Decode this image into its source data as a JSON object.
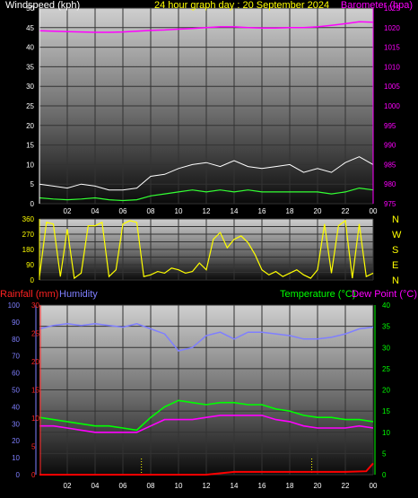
{
  "header": {
    "wind_label": "Windspeed (kph)",
    "title": "24 hour graph day : 20 September 2024",
    "baro_label": "Barometer (hpa)"
  },
  "bottom_labels": {
    "rainfall": "Rainfall (mm)",
    "humidity": "Humidity",
    "temperature": "Temperature (°C)",
    "dewpoint": "Dew Point (°C)"
  },
  "colors": {
    "wind_avg": "#33ff33",
    "wind_gust": "#ffffff",
    "barometer": "#ff00ff",
    "direction": "#ffff00",
    "temperature": "#00ff00",
    "dewpoint": "#ff00ff",
    "humidity": "#7f7fff",
    "rainfall": "#ff0000",
    "sunrise_sunset": "#ffff00"
  },
  "chart_data": [
    {
      "type": "line",
      "name": "wind-and-barometer",
      "x_ticks": [
        "02",
        "04",
        "06",
        "08",
        "10",
        "12",
        "14",
        "16",
        "18",
        "20",
        "22",
        "00"
      ],
      "y_left": {
        "label": "Windspeed (kph)",
        "ylim": [
          0,
          50
        ],
        "ticks": [
          0,
          5,
          10,
          15,
          20,
          25,
          30,
          35,
          40,
          45,
          50
        ]
      },
      "y_right": {
        "label": "Barometer (hpa)",
        "ylim": [
          975,
          1025
        ],
        "ticks": [
          975,
          980,
          985,
          990,
          995,
          1000,
          1005,
          1010,
          1015,
          1020,
          1025
        ]
      },
      "series": [
        {
          "name": "Barometer (hpa)",
          "axis": "right",
          "x": [
            0,
            1,
            2,
            3,
            4,
            5,
            6,
            7,
            8,
            9,
            10,
            11,
            12,
            13,
            14,
            15,
            16,
            17,
            18,
            19,
            20,
            21,
            22,
            23,
            24
          ],
          "values": [
            1019.2,
            1019.1,
            1019.0,
            1018.9,
            1018.8,
            1018.8,
            1018.9,
            1019.1,
            1019.3,
            1019.4,
            1019.6,
            1019.8,
            1020.0,
            1020.2,
            1020.2,
            1020.0,
            1019.9,
            1019.9,
            1020.0,
            1020.0,
            1020.2,
            1020.6,
            1021.0,
            1021.5,
            1021.4
          ]
        },
        {
          "name": "Windspeed average",
          "axis": "left",
          "x": [
            0,
            1,
            2,
            3,
            4,
            5,
            6,
            7,
            8,
            9,
            10,
            11,
            12,
            13,
            14,
            15,
            16,
            17,
            18,
            19,
            20,
            21,
            22,
            23,
            24
          ],
          "values": [
            1.5,
            1.2,
            1.0,
            1.2,
            1.5,
            1.0,
            0.8,
            1.0,
            2.0,
            2.5,
            3.0,
            3.5,
            3.0,
            3.5,
            3.0,
            3.5,
            3.0,
            3.0,
            3.0,
            3.0,
            3.0,
            2.5,
            3.0,
            4.0,
            3.5
          ]
        },
        {
          "name": "Windspeed gust",
          "axis": "left",
          "x": [
            0,
            1,
            2,
            3,
            4,
            5,
            6,
            7,
            8,
            9,
            10,
            11,
            12,
            13,
            14,
            15,
            16,
            17,
            18,
            19,
            20,
            21,
            22,
            23,
            24
          ],
          "values": [
            5.0,
            4.5,
            4.0,
            5.0,
            4.5,
            3.5,
            3.5,
            4.0,
            7.0,
            7.5,
            9.0,
            10.0,
            10.5,
            9.5,
            11.0,
            9.5,
            9.0,
            9.5,
            10.0,
            8.0,
            9.0,
            8.0,
            10.5,
            12.0,
            10.0
          ]
        }
      ]
    },
    {
      "type": "scatter",
      "name": "wind-direction",
      "x_ticks": [],
      "y_left": {
        "ylim": [
          0,
          360
        ],
        "ticks": [
          0,
          45,
          90,
          135,
          180,
          225,
          270,
          315,
          360
        ]
      },
      "y_right": {
        "ticks": [
          "N",
          "W",
          "S",
          "E",
          "N"
        ]
      },
      "series": [
        {
          "name": "Wind direction",
          "x": [
            0,
            0.5,
            1,
            1.5,
            2,
            2.5,
            3,
            3.5,
            4,
            4.5,
            5,
            5.5,
            6,
            6.5,
            7,
            7.5,
            8,
            8.5,
            9,
            9.5,
            10,
            10.5,
            11,
            11.5,
            12,
            12.5,
            13,
            13.5,
            14,
            14.5,
            15,
            15.5,
            16,
            16.5,
            17,
            17.5,
            18,
            18.5,
            19,
            19.5,
            20,
            20.5,
            21,
            21.5,
            22,
            22.5,
            23,
            23.5,
            24
          ],
          "values": [
            20,
            340,
            330,
            20,
            300,
            10,
            40,
            320,
            320,
            340,
            20,
            60,
            330,
            350,
            340,
            20,
            30,
            50,
            40,
            70,
            60,
            40,
            50,
            100,
            60,
            240,
            280,
            190,
            240,
            260,
            220,
            150,
            60,
            30,
            50,
            20,
            40,
            60,
            30,
            10,
            60,
            330,
            40,
            320,
            350,
            10,
            330,
            20,
            40
          ]
        }
      ]
    },
    {
      "type": "line",
      "name": "temperature-humidity-rain",
      "x_ticks": [
        "02",
        "04",
        "06",
        "08",
        "10",
        "12",
        "14",
        "16",
        "18",
        "20",
        "22",
        "00"
      ],
      "y_humidity": {
        "label": "Humidity",
        "ylim": [
          0,
          100
        ],
        "ticks": [
          0,
          5,
          10,
          15,
          20,
          25,
          30,
          35,
          40,
          45,
          50,
          55,
          60,
          65,
          70,
          75,
          80,
          85,
          90,
          95,
          100
        ]
      },
      "y_rain": {
        "label": "Rainfall (mm)",
        "ylim": [
          0,
          30
        ],
        "ticks": [
          0,
          5,
          10,
          15,
          20,
          25,
          30
        ]
      },
      "y_temp": {
        "label": "Temperature (°C)",
        "ylim": [
          0,
          40
        ],
        "ticks": [
          0,
          5,
          10,
          15,
          20,
          25,
          30,
          35,
          40
        ]
      },
      "sunrise_sunset": [
        "07:20",
        "19:35"
      ],
      "series": [
        {
          "name": "Humidity",
          "axis": "humidity",
          "x": [
            0,
            1,
            2,
            3,
            4,
            5,
            6,
            7,
            8,
            9,
            10,
            11,
            12,
            13,
            14,
            15,
            16,
            17,
            18,
            19,
            20,
            21,
            22,
            23,
            24
          ],
          "values": [
            86,
            88,
            89,
            88,
            89,
            88,
            87,
            89,
            86,
            83,
            73,
            75,
            82,
            84,
            80,
            84,
            84,
            83,
            82,
            80,
            80,
            81,
            83,
            86,
            87
          ]
        },
        {
          "name": "Temperature (°C)",
          "axis": "temp",
          "x": [
            0,
            1,
            2,
            3,
            4,
            5,
            6,
            7,
            8,
            9,
            10,
            11,
            12,
            13,
            14,
            15,
            16,
            17,
            18,
            19,
            20,
            21,
            22,
            23,
            24
          ],
          "values": [
            13.5,
            13.0,
            12.5,
            12.0,
            11.5,
            11.5,
            11.0,
            10.5,
            13.5,
            16.0,
            17.5,
            17.0,
            16.5,
            17.0,
            17.0,
            16.5,
            16.5,
            15.5,
            15.0,
            14.0,
            13.5,
            13.5,
            13.0,
            13.0,
            12.5
          ]
        },
        {
          "name": "Dew Point (°C)",
          "axis": "temp",
          "x": [
            0,
            1,
            2,
            3,
            4,
            5,
            6,
            7,
            8,
            9,
            10,
            11,
            12,
            13,
            14,
            15,
            16,
            17,
            18,
            19,
            20,
            21,
            22,
            23,
            24
          ],
          "values": [
            11.5,
            11.5,
            11.0,
            10.5,
            10.0,
            10.0,
            10.0,
            10.0,
            11.5,
            13.0,
            13.0,
            13.0,
            13.5,
            14.0,
            14.0,
            14.0,
            14.0,
            13.0,
            12.5,
            11.5,
            11.0,
            11.0,
            11.0,
            11.5,
            11.0
          ]
        },
        {
          "name": "Rainfall (mm)",
          "axis": "rain",
          "x": [
            0,
            2,
            4,
            6,
            8,
            10,
            12,
            14,
            16,
            18,
            20,
            22,
            23.5,
            24
          ],
          "values": [
            0,
            0,
            0,
            0,
            0,
            0,
            0,
            0.5,
            0.5,
            0.5,
            0.5,
            0.5,
            0.6,
            2.0
          ]
        }
      ]
    }
  ]
}
